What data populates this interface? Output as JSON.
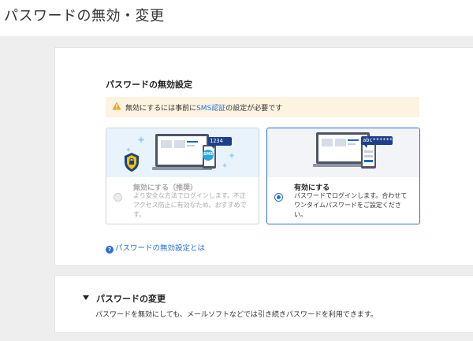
{
  "page": {
    "title": "パスワードの無効・変更"
  },
  "disable_section": {
    "heading": "パスワードの無効設定",
    "alert": {
      "icon": "warning-triangle-icon",
      "text_before": "無効にするには事前に",
      "link": "SMS認証",
      "text_after": "の設定が必要です"
    },
    "options": [
      {
        "title": "無効にする（推奨）",
        "description": "より安全な方法でログインします。不正アクセス防止に有効なため、おすすめです。",
        "badge_code": "1234",
        "badge_sms": "SMS",
        "selected": false,
        "enabled": false
      },
      {
        "title": "有効にする",
        "description": "パスワードでログインします。合わせてワンタイムパスワードをご設定ください。",
        "badge_code": "abc******",
        "selected": true,
        "enabled": true
      }
    ],
    "help_link": "パスワードの無効設定とは"
  },
  "change_section": {
    "heading": "パスワードの変更",
    "description": "パスワードを無効にしても、メールソフトなどでは引き続きパスワードを利用できます。"
  },
  "colors": {
    "accent": "#2a6fd6",
    "alert_bg": "#fcf3e0",
    "warning": "#f0a31c",
    "page_bg": "#eeeeee"
  }
}
